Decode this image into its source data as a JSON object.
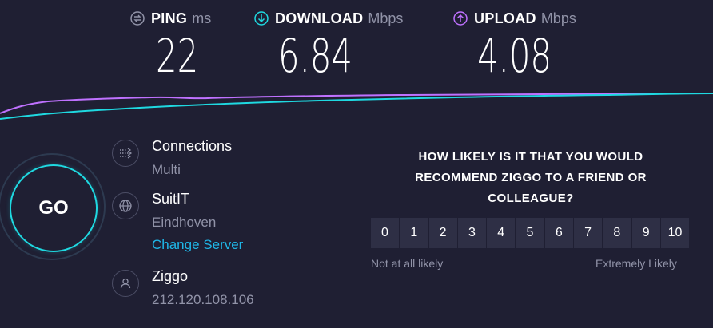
{
  "metrics": {
    "ping": {
      "label": "PING",
      "unit": "ms",
      "value": "22",
      "icon": "ping-icon",
      "color": "#9193a8"
    },
    "download": {
      "label": "DOWNLOAD",
      "unit": "Mbps",
      "value": "6.84",
      "icon": "download-arrow-icon",
      "color": "#1fd9e1"
    },
    "upload": {
      "label": "UPLOAD",
      "unit": "Mbps",
      "value": "4.08",
      "icon": "upload-arrow-icon",
      "color": "#bf71ff"
    }
  },
  "go_button": {
    "label": "GO",
    "color": "#1fd9e1"
  },
  "connections": {
    "title": "Connections",
    "value": "Multi",
    "icon": "connections-icon"
  },
  "server": {
    "title": "SuitIT",
    "location": "Eindhoven",
    "change_link": "Change Server",
    "icon": "globe-icon"
  },
  "provider": {
    "title": "Ziggo",
    "ip": "212.120.108.106",
    "icon": "user-icon"
  },
  "survey": {
    "question": "HOW LIKELY IS IT THAT YOU WOULD RECOMMEND ZIGGO TO A FRIEND OR COLLEAGUE?",
    "options": [
      "0",
      "1",
      "2",
      "3",
      "4",
      "5",
      "6",
      "7",
      "8",
      "9",
      "10"
    ],
    "low_label": "Not at all likely",
    "high_label": "Extremely Likely"
  },
  "colors": {
    "background": "#1f1f33",
    "accent_download": "#1fd9e1",
    "accent_upload": "#bf71ff",
    "muted_text": "#9193a8",
    "link": "#1fb7e8"
  }
}
